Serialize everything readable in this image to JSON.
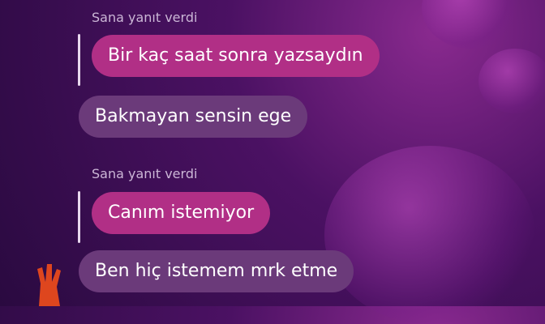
{
  "conversation": {
    "messages": [
      {
        "reply_label": "Sana yanıt verdi",
        "quoted_text": "Bir kaç saat sonra yazsaydın",
        "reply_text": "Bakmayan sensin ege"
      },
      {
        "reply_label": "Sana yanıt verdi",
        "quoted_text": "Canım istemiyor",
        "reply_text": "Ben hiç istemem mrk etme"
      }
    ]
  },
  "colors": {
    "quoted_bubble": "#b12f86",
    "reply_bubble": "#6b3a7a",
    "background": "#4b1163"
  },
  "icons": [
    "heart-decoration",
    "hand-drawing"
  ]
}
